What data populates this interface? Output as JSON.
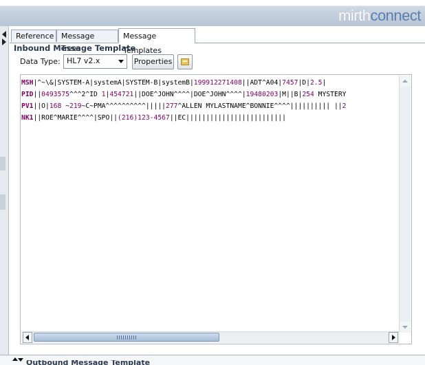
{
  "header": {
    "logo_part1": "mirth",
    "logo_part2": "connect"
  },
  "tabs": [
    {
      "label": "Reference"
    },
    {
      "label": "Message Trees"
    },
    {
      "label": "Message Templates"
    }
  ],
  "template": {
    "title": "Inbound Message Template",
    "data_type_label": "Data Type:",
    "data_type_value": "HL7 v2.x",
    "properties_label": "Properties"
  },
  "editor": {
    "lines": [
      [
        {
          "t": "MSH",
          "c": "sid"
        },
        {
          "t": "|^~\\&|SYSTEM-A|systemA|SYSTEM-B|systemB|",
          "c": "seg"
        },
        {
          "t": "199912271408",
          "c": "num"
        },
        {
          "t": "||ADT^A04|",
          "c": "seg"
        },
        {
          "t": "7457",
          "c": "num"
        },
        {
          "t": "|D|",
          "c": "seg"
        },
        {
          "t": "2.5",
          "c": "num"
        },
        {
          "t": "|",
          "c": "seg"
        }
      ],
      [
        {
          "t": "PID",
          "c": "sid"
        },
        {
          "t": "||",
          "c": "seg"
        },
        {
          "t": "0493575",
          "c": "num"
        },
        {
          "t": "^^^2^ID ",
          "c": "seg"
        },
        {
          "t": "1",
          "c": "num"
        },
        {
          "t": "|",
          "c": "seg"
        },
        {
          "t": "454721",
          "c": "num"
        },
        {
          "t": "||DOE^JOHN^^^^|DOE^JOHN^^^^|",
          "c": "seg"
        },
        {
          "t": "19480203",
          "c": "num"
        },
        {
          "t": "|M||B|",
          "c": "seg"
        },
        {
          "t": "254",
          "c": "num"
        },
        {
          "t": " MYSTERY",
          "c": "seg"
        }
      ],
      [
        {
          "t": "PV1",
          "c": "sid"
        },
        {
          "t": "||O|",
          "c": "seg"
        },
        {
          "t": "168",
          "c": "num"
        },
        {
          "t": " ~",
          "c": "seg"
        },
        {
          "t": "219",
          "c": "num"
        },
        {
          "t": "~C~PMA^^^^^^^^^^|||||",
          "c": "seg"
        },
        {
          "t": "277",
          "c": "num"
        },
        {
          "t": "^ALLEN MYLASTNAME^BONNIE^^^^|||||||||| ||",
          "c": "seg"
        },
        {
          "t": "2",
          "c": "num"
        }
      ],
      [
        {
          "t": "NK1",
          "c": "sid"
        },
        {
          "t": "||ROE^MARIE^^^^|SPO||",
          "c": "seg"
        },
        {
          "t": "(216)",
          "c": "num"
        },
        {
          "t": "123-4567",
          "c": "num"
        },
        {
          "t": "||EC|||||||||||||||||||||||||",
          "c": "seg"
        }
      ]
    ]
  },
  "footer": {
    "partial_label": "Outbound Message Template"
  },
  "colors": {
    "segment_id": "#800060",
    "number": "#800060",
    "topbar": "#b7c5d5",
    "accent": "#5a7fae"
  }
}
